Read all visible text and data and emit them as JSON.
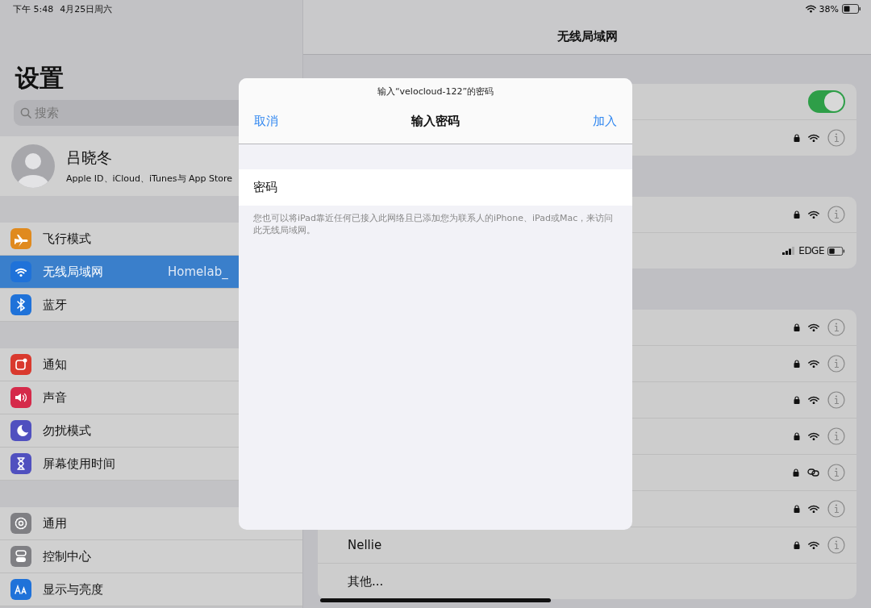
{
  "status_bar": {
    "time": "下午 5:48",
    "date": "4月25日周六",
    "battery": "38%"
  },
  "sidebar": {
    "title": "设置",
    "search": {
      "placeholder": "搜索"
    },
    "profile": {
      "name": "吕晓冬",
      "subtitle": "Apple ID、iCloud、iTunes与 App Store"
    },
    "groups": [
      [
        {
          "label": "飞行模式",
          "kind": "airplane",
          "color": "#e08a1e",
          "selected": false
        },
        {
          "label": "无线局域网",
          "kind": "wifi",
          "color": "#1f72d9",
          "selected": true,
          "value": "Homelab_"
        },
        {
          "label": "蓝牙",
          "kind": "bluetooth",
          "color": "#1f72d9",
          "selected": false
        }
      ],
      [
        {
          "label": "通知",
          "kind": "notification",
          "color": "#d9392e",
          "selected": false
        },
        {
          "label": "声音",
          "kind": "speaker",
          "color": "#d52a4a",
          "selected": false
        },
        {
          "label": "勿扰模式",
          "kind": "moon",
          "color": "#5050bf",
          "selected": false
        },
        {
          "label": "屏幕使用时间",
          "kind": "hourglass",
          "color": "#5050bf",
          "selected": false
        }
      ],
      [
        {
          "label": "通用",
          "kind": "gear",
          "color": "#7f7f83",
          "selected": false
        },
        {
          "label": "控制中心",
          "kind": "toggles",
          "color": "#7f7f83",
          "selected": false
        },
        {
          "label": "显示与亮度",
          "kind": "textsize",
          "color": "#1f72d9",
          "selected": false
        }
      ]
    ]
  },
  "detail": {
    "title": "无线局域网",
    "groups": [
      [
        {
          "kind": "toggle",
          "on": true
        },
        {
          "kind": "network",
          "locked": true
        }
      ],
      [
        {
          "kind": "network",
          "locked": true
        },
        {
          "kind": "hotspot",
          "network": "EDGE"
        }
      ],
      [
        {
          "kind": "network",
          "locked": true
        },
        {
          "kind": "network",
          "locked": true
        },
        {
          "kind": "network",
          "locked": true
        },
        {
          "kind": "network",
          "locked": true
        },
        {
          "kind": "linked",
          "locked": true
        },
        {
          "kind": "network",
          "locked": true
        },
        {
          "kind": "network",
          "label": "Nellie",
          "locked": true
        },
        {
          "kind": "other",
          "label": "其他..."
        }
      ]
    ]
  },
  "dialog": {
    "caption": "输入“velocloud-122”的密码",
    "cancel": "取消",
    "title": "输入密码",
    "join": "加入",
    "field_label": "密码",
    "note": "您也可以将iPad靠近任何已接入此网络且已添加您为联系人的iPhone、iPad或Mac，来访问此无线局域网。"
  }
}
